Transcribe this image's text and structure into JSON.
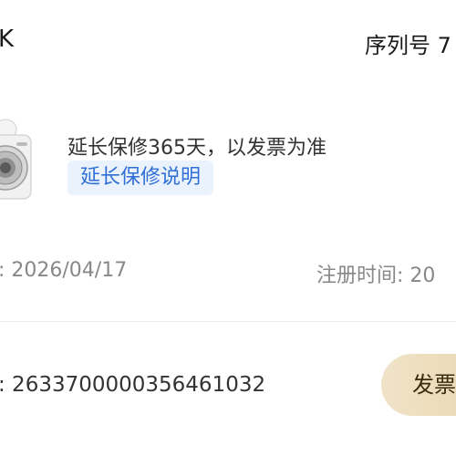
{
  "header": {
    "model": "K",
    "serial_label": "序列号 7"
  },
  "warranty": {
    "extension_text": "延长保修365天，以发票为准",
    "info_link": "延长保修说明"
  },
  "dates": {
    "purchase_date": ": 2026/04/17",
    "register_time": "注册时间: 20"
  },
  "invoice": {
    "number": ": 2633700000356461032",
    "button_label": "发票"
  },
  "colors": {
    "link_blue": "#2f6fd6",
    "tag_bg": "#eaf3fd",
    "button_gold": "#eddbb8"
  }
}
